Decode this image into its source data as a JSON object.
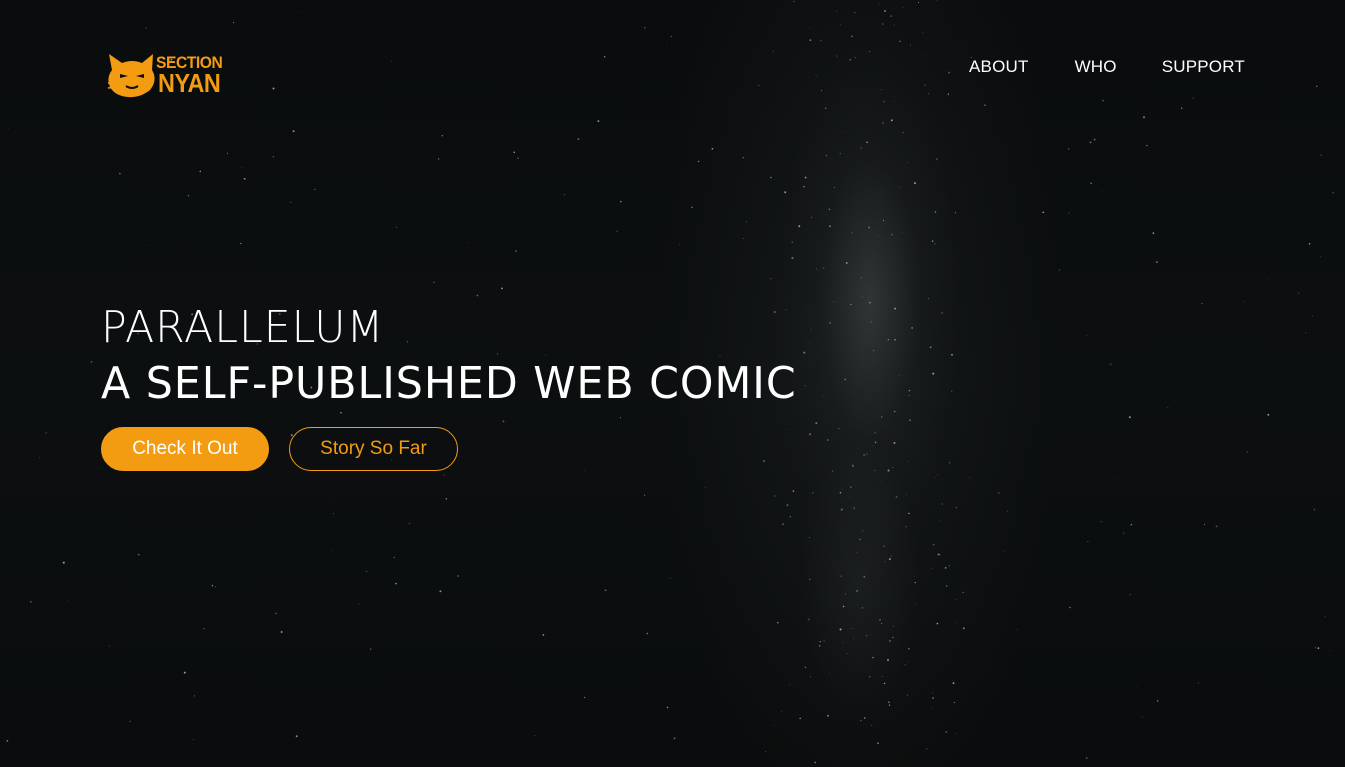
{
  "brand": {
    "logo_line1": "SECTION",
    "logo_line2": "NYAN",
    "logo_icon": "cat-head-icon",
    "accent_color": "#f39c12"
  },
  "nav": {
    "items": [
      {
        "label": "ABOUT"
      },
      {
        "label": "WHO"
      },
      {
        "label": "SUPPORT"
      }
    ]
  },
  "hero": {
    "title": "PARALLELUM",
    "subtitle": "A SELF-PUBLISHED WEB COMIC",
    "primary_button": "Check It Out",
    "secondary_button": "Story So Far"
  },
  "theme": {
    "background": "#0b0d0e",
    "text": "#ffffff",
    "accent": "#f39c12"
  }
}
